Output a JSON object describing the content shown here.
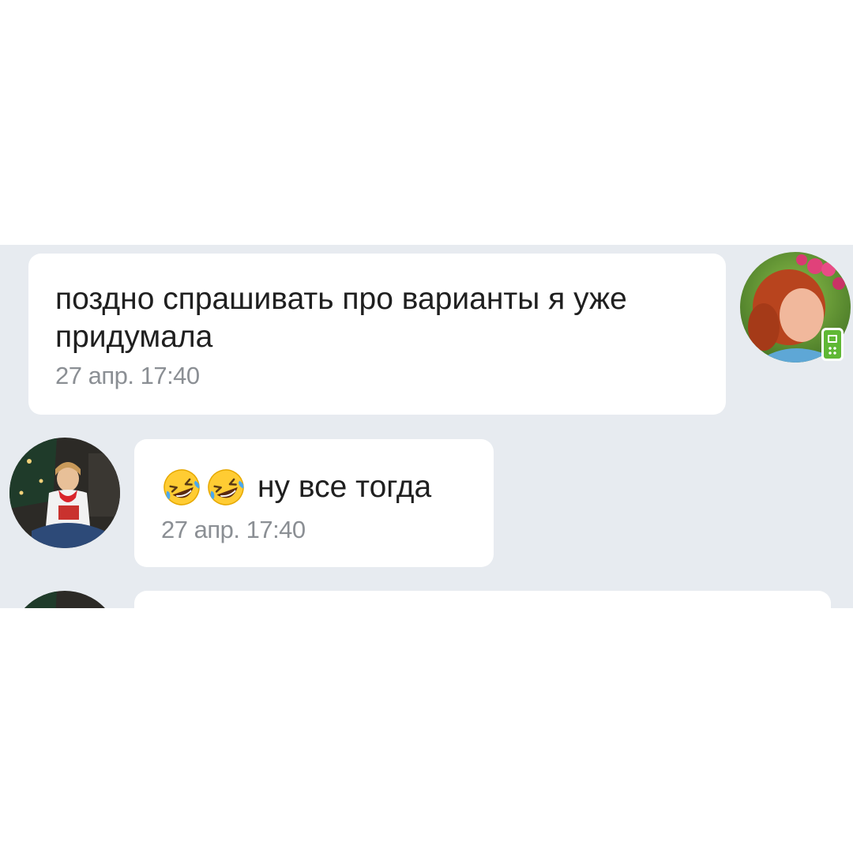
{
  "messages": [
    {
      "text": "поздно спрашивать про варианты я уже придумала",
      "time": "27 апр. 17:40",
      "side": "right"
    },
    {
      "emoji": [
        "rolling-on-floor-laughing",
        "rolling-on-floor-laughing"
      ],
      "text": "ну все тогда",
      "time": "27 апр. 17:40",
      "side": "left"
    }
  ],
  "colors": {
    "chat_background": "#e7ebf0",
    "bubble": "#ffffff",
    "text": "#1f1f1f",
    "timestamp": "#8b8f94",
    "online_mobile_badge": "#5fb835"
  },
  "icons": {
    "online_badge": "mobile-online-icon"
  }
}
